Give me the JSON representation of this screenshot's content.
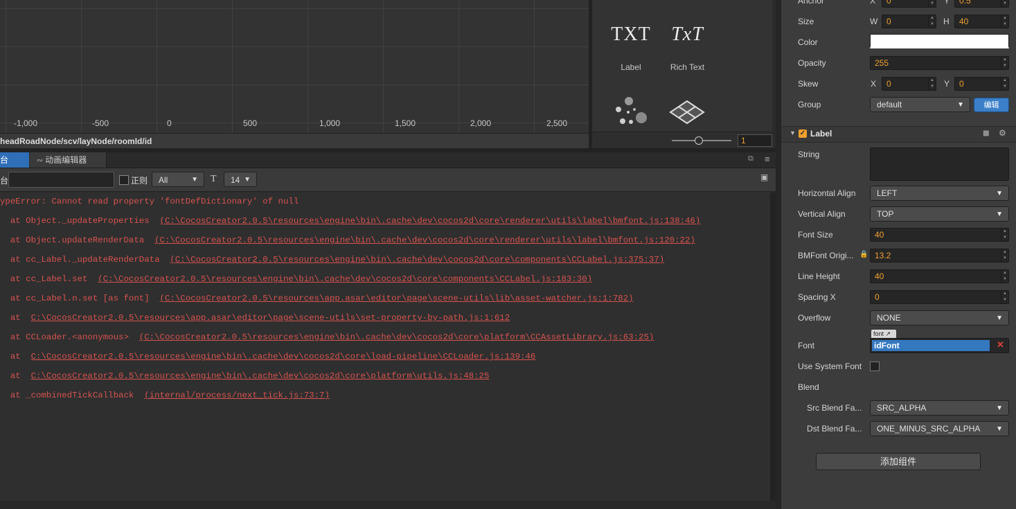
{
  "scene": {
    "ticks": [
      "-1,000",
      "-500",
      "0",
      "500",
      "1,000",
      "1,500",
      "2,000",
      "2,500"
    ],
    "breadcrumb": "headRoadNode/scv/layNode/roomId/id"
  },
  "library": {
    "items": [
      {
        "glyph": "TXT",
        "label": "Label"
      },
      {
        "glyph": "TxT",
        "label": "Rich Text"
      }
    ],
    "zoom_value": "1"
  },
  "console": {
    "tabs": [
      "台",
      "动画编辑器"
    ],
    "toolbar": {
      "filter_prefix": "台",
      "regex_label": "正则",
      "level_select": "All",
      "font_size_select": "14"
    },
    "lines": [
      {
        "text": "ypeError: Cannot read property 'fontDefDictionary' of null",
        "link": ""
      },
      {
        "text": "  at Object._updateProperties  ",
        "link": "(C:\\CocosCreator2.0.5\\resources\\engine\\bin\\.cache\\dev\\cocos2d\\core\\renderer\\utils\\label\\bmfont.js:138:46)"
      },
      {
        "text": "  at Object.updateRenderData  ",
        "link": "(C:\\CocosCreator2.0.5\\resources\\engine\\bin\\.cache\\dev\\cocos2d\\core\\renderer\\utils\\label\\bmfont.js:120:22)"
      },
      {
        "text": "  at cc_Label._updateRenderData  ",
        "link": "(C:\\CocosCreator2.0.5\\resources\\engine\\bin\\.cache\\dev\\cocos2d\\core\\components\\CCLabel.js:375:37)"
      },
      {
        "text": "  at cc_Label.set  ",
        "link": "(C:\\CocosCreator2.0.5\\resources\\engine\\bin\\.cache\\dev\\cocos2d\\core\\components\\CCLabel.js:183:30)"
      },
      {
        "text": "  at cc_Label.n.set [as font]  ",
        "link": "(C:\\CocosCreator2.0.5\\resources\\app.asar\\editor\\page\\scene-utils\\lib\\asset-watcher.js:1:782)"
      },
      {
        "text": "  at  ",
        "link": "C:\\CocosCreator2.0.5\\resources\\app.asar\\editor\\page\\scene-utils\\set-property-by-path.js:1:612"
      },
      {
        "text": "  at CCLoader.<anonymous>  ",
        "link": "(C:\\CocosCreator2.0.5\\resources\\engine\\bin\\.cache\\dev\\cocos2d\\core\\platform\\CCAssetLibrary.js:63:25)"
      },
      {
        "text": "  at  ",
        "link": "C:\\CocosCreator2.0.5\\resources\\engine\\bin\\.cache\\dev\\cocos2d\\core\\load-pipeline\\CCLoader.js:139:46"
      },
      {
        "text": "  at  ",
        "link": "C:\\CocosCreator2.0.5\\resources\\engine\\bin\\.cache\\dev\\cocos2d\\core\\platform\\utils.js:48:25"
      },
      {
        "text": "  at _combinedTickCallback  ",
        "link": "(internal/process/next_tick.js:73:7)"
      }
    ]
  },
  "inspector": {
    "anchor": {
      "label": "Anchor",
      "x_axis": "X",
      "x": "0",
      "y_axis": "Y",
      "y": "0.5"
    },
    "size": {
      "label": "Size",
      "w_axis": "W",
      "w": "0",
      "h_axis": "H",
      "h": "40"
    },
    "color": {
      "label": "Color",
      "value": "#ffffff"
    },
    "opacity": {
      "label": "Opacity",
      "value": "255"
    },
    "skew": {
      "label": "Skew",
      "x_axis": "X",
      "x": "0",
      "y_axis": "Y",
      "y": "0"
    },
    "group": {
      "label": "Group",
      "value": "default",
      "edit_button": "编辑"
    },
    "component_title": "Label",
    "string": {
      "label": "String",
      "value": ""
    },
    "horizontal_align": {
      "label": "Horizontal Align",
      "value": "LEFT"
    },
    "vertical_align": {
      "label": "Vertical Align",
      "value": "TOP"
    },
    "font_size": {
      "label": "Font Size",
      "value": "40"
    },
    "bmfont_size": {
      "label": "BMFont Origi...",
      "value": "13.2"
    },
    "line_height": {
      "label": "Line Height",
      "value": "40"
    },
    "spacing_x": {
      "label": "Spacing X",
      "value": "0"
    },
    "overflow": {
      "label": "Overflow",
      "value": "NONE"
    },
    "font": {
      "label": "Font",
      "tag": "font",
      "value": "idFont"
    },
    "use_system_font": {
      "label": "Use System Font",
      "checked": false
    },
    "blend": {
      "label": "Blend"
    },
    "src_blend": {
      "label": "Src Blend Fa...",
      "value": "SRC_ALPHA"
    },
    "dst_blend": {
      "label": "Dst Blend Fa...",
      "value": "ONE_MINUS_SRC_ALPHA"
    },
    "add_component": "添加组件"
  },
  "colors": {
    "accent": "#2f6fb8",
    "error_text": "#d9534f",
    "number_value": "#f0a030"
  }
}
